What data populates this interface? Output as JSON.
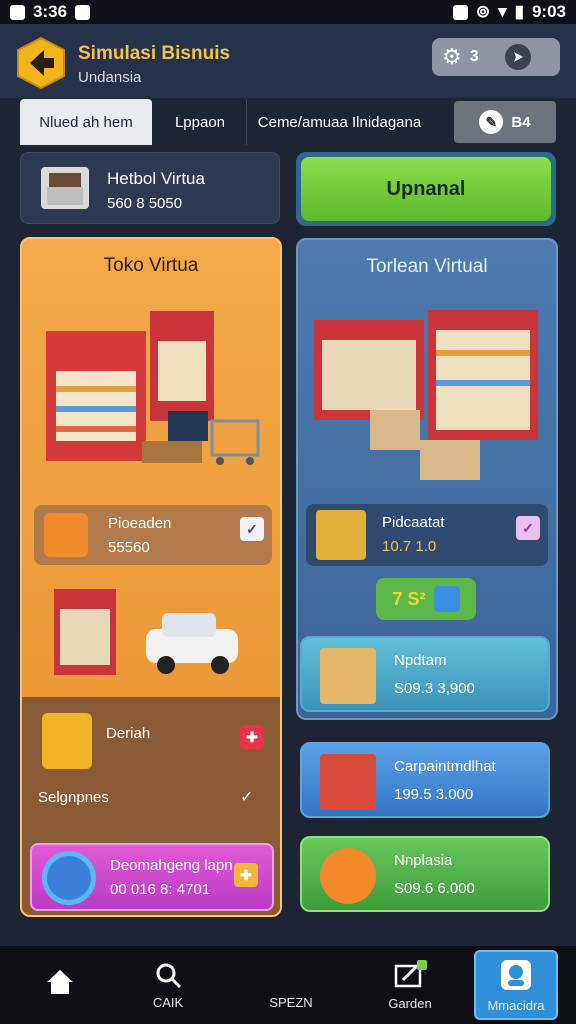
{
  "status": {
    "left_time": "3:36",
    "right_time": "9:03"
  },
  "header": {
    "title": "Simulasi Bisnuis",
    "subtitle": "Undansia",
    "settings_count": "3"
  },
  "tabs": [
    {
      "label": "Nlued ah hem"
    },
    {
      "label": "Lppaon"
    },
    {
      "label": "Ceme/amuaa Ilnidagana"
    },
    {
      "label": "B4"
    }
  ],
  "store": {
    "title": "Hetbol Virtua",
    "value": "560 8 5050"
  },
  "upgrade": {
    "label": "Upnanal"
  },
  "left_panel": {
    "title": "Toko Virtua",
    "card1": {
      "label": "Pioeaden",
      "value": "55560"
    },
    "card2": {
      "label": "Deriah",
      "sub": "Selgnpnes"
    },
    "card3": {
      "label": "Deomahgeng lapn",
      "value": "00 016 8: 4701"
    }
  },
  "right_panel": {
    "title": "Torlean Virtual",
    "card1": {
      "label": "Pidcaatat",
      "value": "10.7 1.0"
    },
    "chip": "7 S²"
  },
  "list": [
    {
      "label": "Npdtam",
      "value": "S09.3 3,900"
    },
    {
      "label": "Carpaintmdlhat",
      "value": "199.5 3.000"
    },
    {
      "label": "Nnplasia",
      "value": "S09.6 6.000"
    }
  ],
  "nav": [
    {
      "label": ""
    },
    {
      "label": "CAIK"
    },
    {
      "label": "SPEZN"
    },
    {
      "label": "Garden"
    },
    {
      "label": "Mmacidra"
    }
  ],
  "colors": {
    "accent_green": "#6fcf3a",
    "panel_orange": "#f0a040",
    "panel_blue": "#4a76aa",
    "nav_active": "#2f8fd8"
  }
}
